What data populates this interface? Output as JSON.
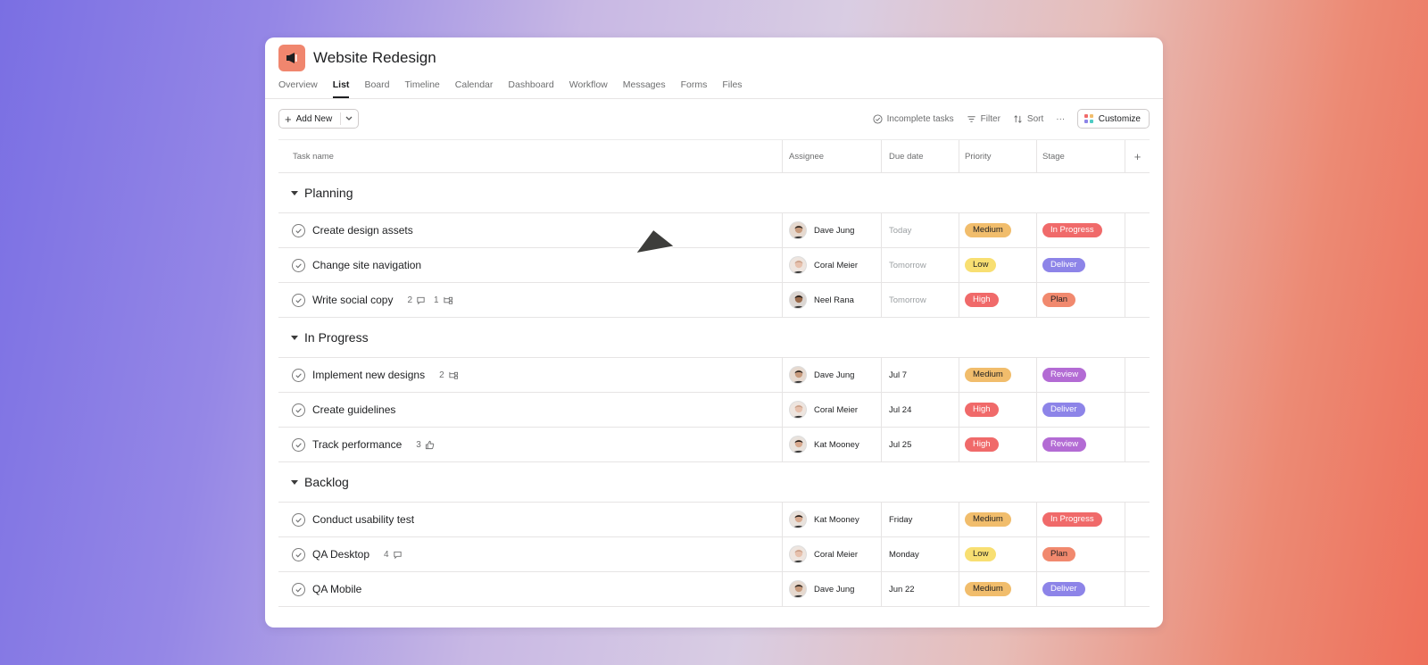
{
  "project": {
    "title": "Website Redesign",
    "icon": "megaphone-icon",
    "icon_color": "#f0866e"
  },
  "tabs": [
    "Overview",
    "List",
    "Board",
    "Timeline",
    "Calendar",
    "Dashboard",
    "Workflow",
    "Messages",
    "Forms",
    "Files"
  ],
  "active_tab": "List",
  "toolbar": {
    "add_new": "Add New",
    "incomplete": "Incomplete tasks",
    "filter": "Filter",
    "sort": "Sort",
    "more": "···",
    "customize": "Customize"
  },
  "columns": {
    "task": "Task name",
    "assignee": "Assignee",
    "due": "Due date",
    "priority": "Priority",
    "stage": "Stage",
    "add": "+"
  },
  "colors": {
    "priority": {
      "Medium": "#f1bd6c",
      "Low": "#f8df72",
      "High": "#f06a6a"
    },
    "stage": {
      "In Progress": "#f06a6a",
      "Deliver": "#8d84e8",
      "Plan": "#f1896e",
      "Review": "#b36bd4"
    }
  },
  "sections": [
    {
      "name": "Planning",
      "tasks": [
        {
          "name": "Create design assets",
          "meta": [],
          "assignee": "Dave Jung",
          "due": "Today",
          "due_muted": true,
          "priority": "Medium",
          "stage": "In Progress"
        },
        {
          "name": "Change site navigation",
          "meta": [],
          "assignee": "Coral Meier",
          "due": "Tomorrow",
          "due_muted": true,
          "priority": "Low",
          "stage": "Deliver"
        },
        {
          "name": "Write social copy",
          "meta": [
            {
              "count": "2",
              "icon": "comment-icon"
            },
            {
              "count": "1",
              "icon": "subtask-icon"
            }
          ],
          "assignee": "Neel Rana",
          "due": "Tomorrow",
          "due_muted": true,
          "priority": "High",
          "stage": "Plan"
        }
      ]
    },
    {
      "name": "In Progress",
      "tasks": [
        {
          "name": "Implement new designs",
          "meta": [
            {
              "count": "2",
              "icon": "subtask-icon"
            }
          ],
          "assignee": "Dave Jung",
          "due": "Jul 7",
          "due_muted": false,
          "priority": "Medium",
          "stage": "Review"
        },
        {
          "name": "Create guidelines",
          "meta": [],
          "assignee": "Coral Meier",
          "due": "Jul 24",
          "due_muted": false,
          "priority": "High",
          "stage": "Deliver"
        },
        {
          "name": "Track performance",
          "meta": [
            {
              "count": "3",
              "icon": "thumbs-up-icon"
            }
          ],
          "assignee": "Kat Mooney",
          "due": "Jul 25",
          "due_muted": false,
          "priority": "High",
          "stage": "Review"
        }
      ]
    },
    {
      "name": "Backlog",
      "tasks": [
        {
          "name": "Conduct usability test",
          "meta": [],
          "assignee": "Kat Mooney",
          "due": "Friday",
          "due_muted": false,
          "priority": "Medium",
          "stage": "In Progress"
        },
        {
          "name": "QA Desktop",
          "meta": [
            {
              "count": "4",
              "icon": "comment-icon"
            }
          ],
          "assignee": "Coral Meier",
          "due": "Monday",
          "due_muted": false,
          "priority": "Low",
          "stage": "Plan"
        },
        {
          "name": "QA Mobile",
          "meta": [],
          "assignee": "Dave Jung",
          "due": "Jun 22",
          "due_muted": false,
          "priority": "Medium",
          "stage": "Deliver"
        }
      ]
    }
  ]
}
